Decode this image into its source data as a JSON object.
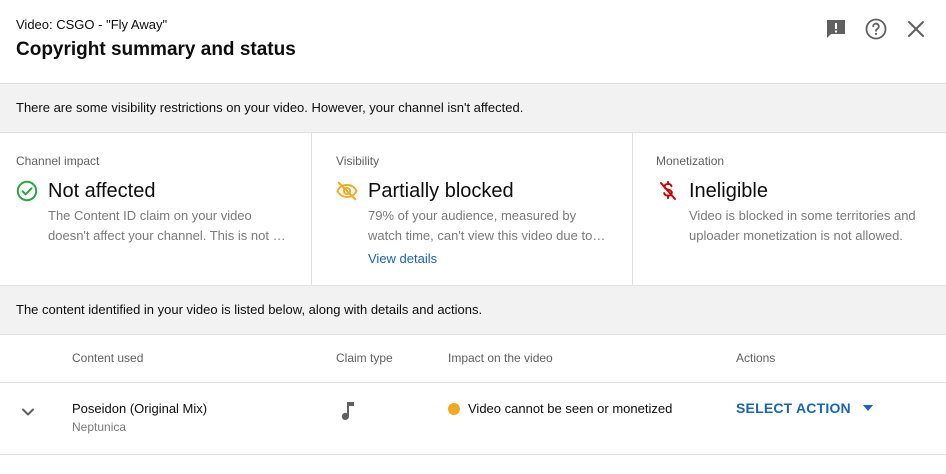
{
  "header": {
    "video_label": "Video: CSGO - \"Fly Away\"",
    "title": "Copyright summary and status",
    "icons": [
      "feedback-icon",
      "help-icon",
      "close-icon"
    ]
  },
  "banner_restrictions": "There are some visibility restrictions on your video. However, your channel isn't affected.",
  "panels": {
    "channel_impact": {
      "label": "Channel impact",
      "status": "Not affected",
      "desc_line1": "The Content ID claim on your video",
      "desc_line2": "doesn't affect your channel. This is not …",
      "icon": "check-circle-icon",
      "color": "#2ba640"
    },
    "visibility": {
      "label": "Visibility",
      "status": "Partially blocked",
      "desc_line1": "79% of your audience, measured by",
      "desc_line2": "watch time, can't view this video due to…",
      "link": "View details",
      "icon": "visibility-off-icon",
      "color": "#f4a820"
    },
    "monetization": {
      "label": "Monetization",
      "status": "Ineligible",
      "desc_line1": "Video is blocked in some territories and",
      "desc_line2": "uploader monetization is not allowed.",
      "icon": "money-off-icon",
      "color": "#cc0000"
    }
  },
  "banner_content": "The content identified in your video is listed below, along with details and actions.",
  "table": {
    "columns": [
      "Content used",
      "Claim type",
      "Impact on the video",
      "Actions"
    ],
    "rows": [
      {
        "title": "Poseidon (Original Mix)",
        "artist": "Neptunica",
        "claim_type_icon": "music-note-icon",
        "impact": "Video cannot be seen or monetized",
        "impact_color": "#f4a820",
        "action": "SELECT ACTION"
      }
    ]
  }
}
